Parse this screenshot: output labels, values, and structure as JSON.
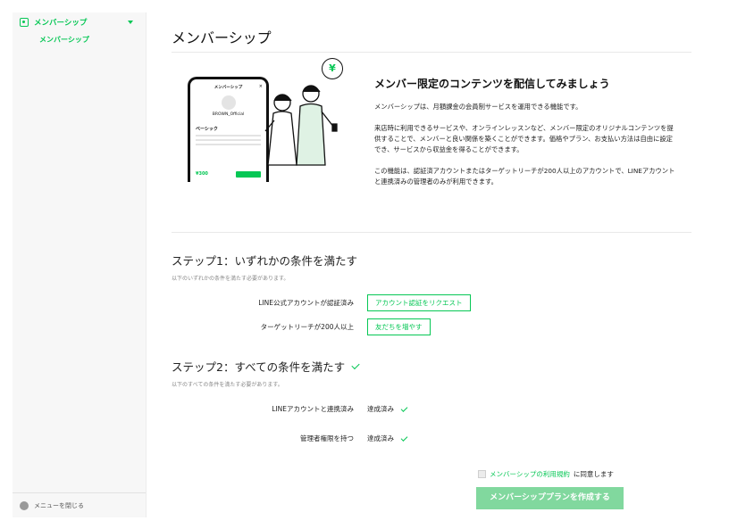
{
  "sidebar": {
    "section_label": "メンバーシップ",
    "sub_item_label": "メンバーシップ",
    "footer_label": "メニューを閉じる"
  },
  "page": {
    "title": "メンバーシップ"
  },
  "hero": {
    "heading": "メンバー限定のコンテンツを配信してみましょう",
    "paragraphs": [
      "メンバーシップは、月額課金の会員制サービスを運用できる機能です。",
      "来店時に利用できるサービスや、オンラインレッスンなど、メンバー限定のオリジナルコンテンツを提供することで、メンバーと良い関係を築くことができます。価格やプラン、お支払い方法は自由に設定でき、サービスから収益金を得ることができます。",
      "この機能は、認証済アカウントまたはターゲットリーチが200人以上のアカウントで、LINEアカウントと連携済みの管理者のみが利用できます。"
    ],
    "phone": {
      "title": "メンバーシップ",
      "account": "BROWN_Official",
      "plan_label": "ベーシック",
      "price": "¥300"
    },
    "currency_symbol": "¥"
  },
  "step1": {
    "title": "ステップ1：いずれかの条件を満たす",
    "subtitle": "以下のいずれかの条件を満たす必要があります。",
    "rows": [
      {
        "label": "LINE公式アカウントが認証済み",
        "button": "アカウント認証をリクエスト"
      },
      {
        "label": "ターゲットリーチが200人以上",
        "button": "友だちを増やす"
      }
    ]
  },
  "step2": {
    "title": "ステップ2：すべての条件を満たす",
    "subtitle": "以下のすべての条件を満たす必要があります。",
    "rows": [
      {
        "label": "LINEアカウントと連携済み",
        "status": "達成済み"
      },
      {
        "label": "管理者権限を持つ",
        "status": "達成済み"
      }
    ]
  },
  "agreement": {
    "link_text": "メンバーシップの利用規約",
    "suffix": "に同意します"
  },
  "cta": {
    "label": "メンバーシッププランを作成する"
  },
  "colors": {
    "accent": "#06c755",
    "cta_disabled": "#81d89e"
  }
}
